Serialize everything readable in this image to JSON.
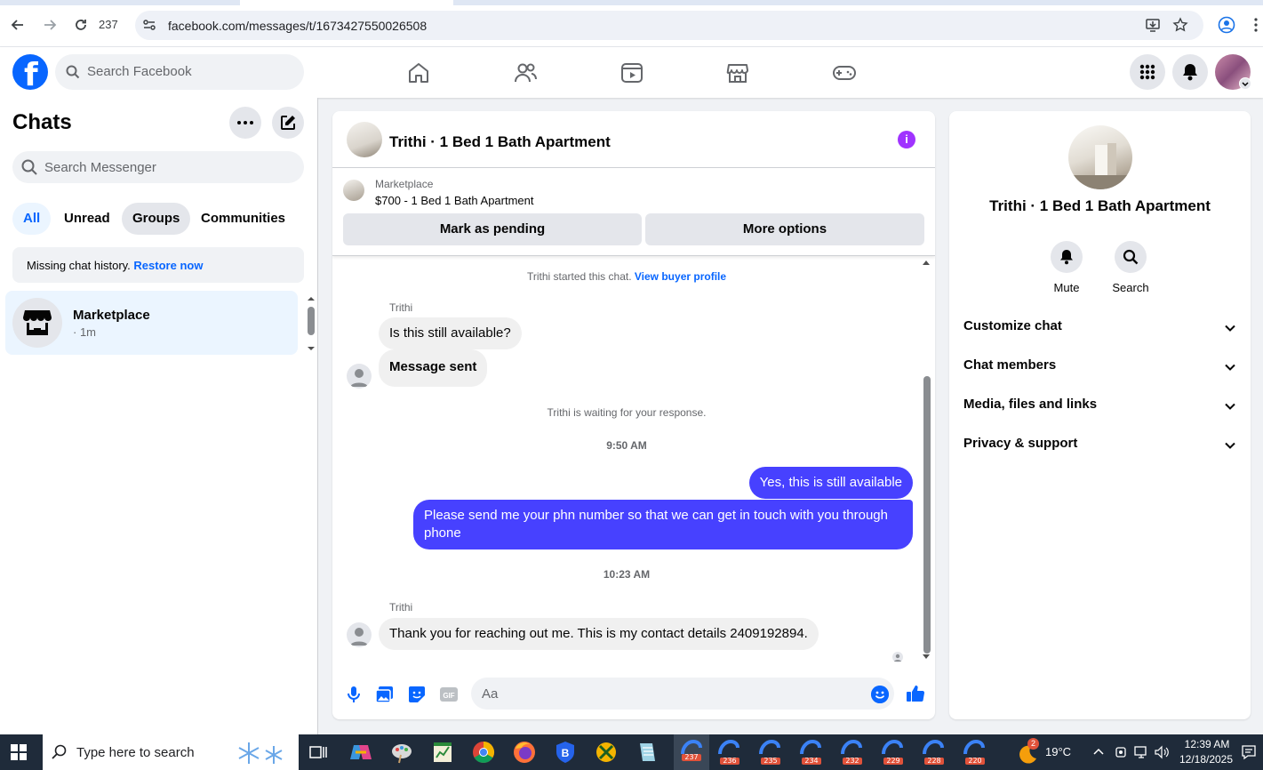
{
  "browser": {
    "tab_count": "237",
    "url": "facebook.com/messages/t/1673427550026508"
  },
  "fb_header": {
    "search_placeholder": "Search Facebook"
  },
  "sidebar": {
    "title": "Chats",
    "search_placeholder": "Search Messenger",
    "filters": [
      "All",
      "Unread",
      "Groups",
      "Communities"
    ],
    "missing_history_text": "Missing chat history.",
    "restore_link": "Restore now",
    "chat_item": {
      "name": "Marketplace",
      "time": "· 1m"
    }
  },
  "conversation": {
    "title": "Trithi · 1 Bed 1 Bath Apartment",
    "marketplace_label": "Marketplace",
    "listing": "$700 - 1 Bed 1 Bath Apartment",
    "mark_pending_label": "Mark as pending",
    "more_options_label": "More options",
    "started_text": "Trithi started this chat.",
    "buyer_profile_link": "View buyer profile",
    "messages": [
      {
        "sender": "Trithi",
        "text": "Is this still available?"
      },
      {
        "text": "Message sent"
      },
      {
        "text": "Yes, this is still available"
      },
      {
        "text": "Please send me your phn number so that we can get in touch with you through phone"
      },
      {
        "sender": "Trithi",
        "text": "Thank you for  reaching out me. This is my contact details 2409192894."
      }
    ],
    "waiting_text": "Trithi is waiting for your response.",
    "timestamp_1": "9:50 AM",
    "timestamp_2": "10:23 AM",
    "input_placeholder": "Aa"
  },
  "info_panel": {
    "name": "Trithi · 1 Bed 1 Bath Apartment",
    "actions": [
      "Mute",
      "Search"
    ],
    "sections": [
      "Customize chat",
      "Chat members",
      "Media, files and links",
      "Privacy & support"
    ]
  },
  "taskbar": {
    "search_placeholder": "Type here to search",
    "tab_badges": [
      "237",
      "236",
      "235",
      "234",
      "232",
      "229",
      "228",
      "220"
    ],
    "weather_badge": "2",
    "temperature": "19°C",
    "time": "12:39 AM",
    "date": "12/18/2025"
  },
  "colors": {
    "fb_blue": "#0866ff",
    "outgoing_bubble": "#4741ff",
    "info_purple": "#a033ff"
  }
}
